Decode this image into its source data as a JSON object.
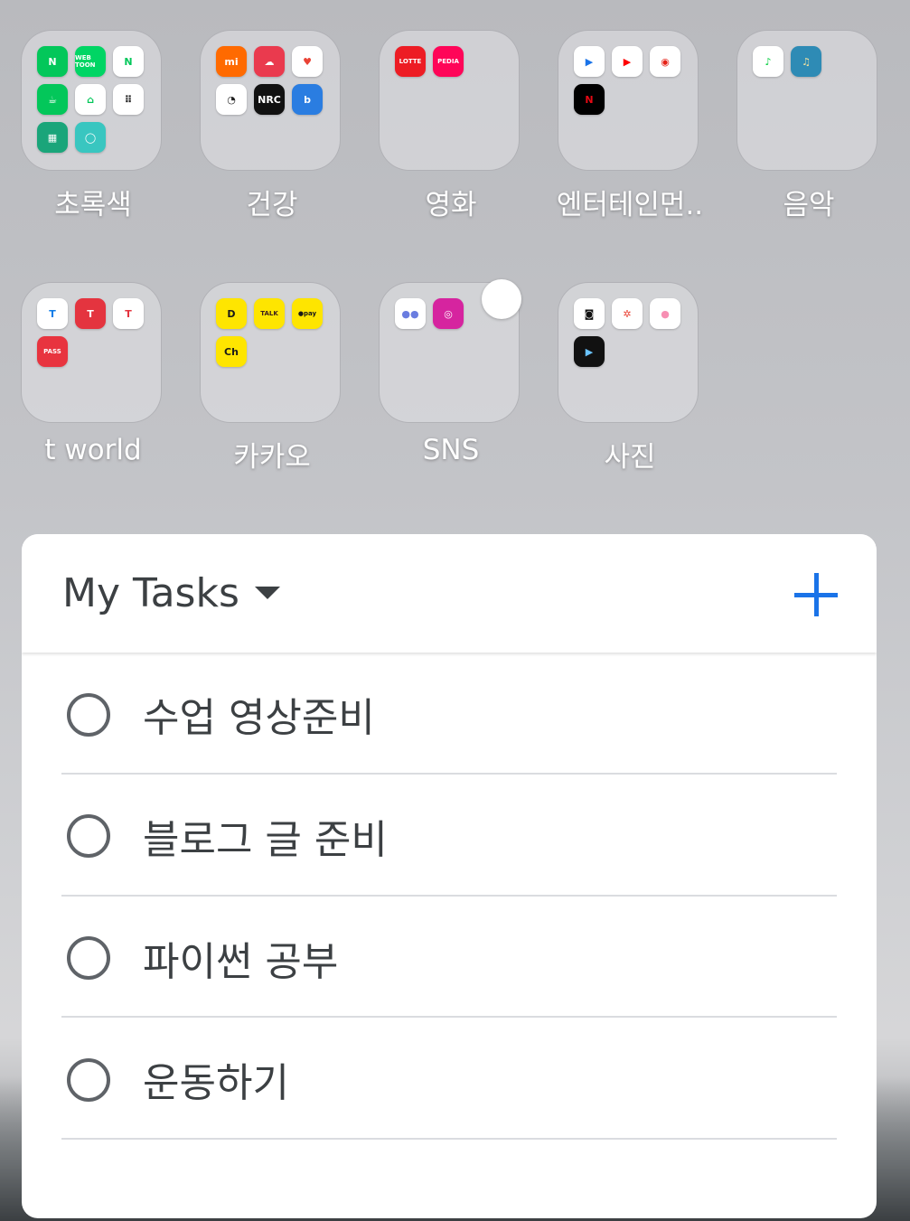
{
  "folders": [
    {
      "label": "초록색",
      "apps": [
        {
          "name": "naver-icon",
          "text": "N",
          "bg": "#03c75a",
          "fg": "#ffffff"
        },
        {
          "name": "webtoon-icon",
          "text": "WEB TOON",
          "bg": "#00d564",
          "fg": "#ffffff"
        },
        {
          "name": "naver-map-icon",
          "text": "N",
          "bg": "#ffffff",
          "fg": "#03c75a"
        },
        {
          "name": "cafe-icon",
          "text": "☕",
          "bg": "#03c75a",
          "fg": "#ffffff"
        },
        {
          "name": "real-estate-icon",
          "text": "⌂",
          "bg": "#ffffff",
          "fg": "#03c75a"
        },
        {
          "name": "dots-app-icon",
          "text": "⠿",
          "bg": "#ffffff",
          "fg": "#222222"
        },
        {
          "name": "building-icon",
          "text": "▦",
          "bg": "#1aa57a",
          "fg": "#ffffff"
        },
        {
          "name": "circle-app-icon",
          "text": "◯",
          "bg": "#39c6c0",
          "fg": "#ffffff"
        }
      ]
    },
    {
      "label": "건강",
      "apps": [
        {
          "name": "mi-fit-icon",
          "text": "mi",
          "bg": "#ff6a00",
          "fg": "#ffffff"
        },
        {
          "name": "health-cloud-icon",
          "text": "☁",
          "bg": "#ea3a4e",
          "fg": "#ffffff"
        },
        {
          "name": "google-fit-icon",
          "text": "♥",
          "bg": "#ffffff",
          "fg": "#e94235"
        },
        {
          "name": "timer-icon",
          "text": "◔",
          "bg": "#ffffff",
          "fg": "#222222"
        },
        {
          "name": "nike-run-club-icon",
          "text": "NRC",
          "bg": "#111111",
          "fg": "#ffffff"
        },
        {
          "name": "blue-fit-icon",
          "text": "b",
          "bg": "#2a7de1",
          "fg": "#ffffff"
        }
      ]
    },
    {
      "label": "영화",
      "apps": [
        {
          "name": "lotte-cinema-icon",
          "text": "LOTTE",
          "bg": "#ed1c24",
          "fg": "#ffffff"
        },
        {
          "name": "watcha-pedia-icon",
          "text": "PEDIA",
          "bg": "#ff0558",
          "fg": "#ffffff"
        }
      ]
    },
    {
      "label": "엔터테인먼..",
      "apps": [
        {
          "name": "play-store-icon",
          "text": "▶",
          "bg": "#ffffff",
          "fg": "#1a73e8"
        },
        {
          "name": "youtube-icon",
          "text": "▶",
          "bg": "#ffffff",
          "fg": "#ff0000"
        },
        {
          "name": "youtube-music-icon",
          "text": "◉",
          "bg": "#ffffff",
          "fg": "#e62117"
        },
        {
          "name": "netflix-icon",
          "text": "N",
          "bg": "#000000",
          "fg": "#e50914"
        }
      ]
    },
    {
      "label": "음악",
      "apps": [
        {
          "name": "melon-icon",
          "text": "♪",
          "bg": "#ffffff",
          "fg": "#00cd3c"
        },
        {
          "name": "tuner-icon",
          "text": "♫",
          "bg": "#2e8bb5",
          "fg": "#f4e2a0"
        }
      ]
    },
    {
      "label": "t world",
      "apps": [
        {
          "name": "tmap-icon",
          "text": "T",
          "bg": "#ffffff",
          "fg": "#0d7ce8"
        },
        {
          "name": "t-world-icon",
          "text": "T",
          "bg": "#e4343f",
          "fg": "#ffffff"
        },
        {
          "name": "t-membership-icon",
          "text": "T",
          "bg": "#ffffff",
          "fg": "#e4343f"
        },
        {
          "name": "pass-icon",
          "text": "PASS",
          "bg": "#e8343f",
          "fg": "#ffffff"
        }
      ]
    },
    {
      "label": "카카오",
      "apps": [
        {
          "name": "kakao-d-icon",
          "text": "D",
          "bg": "#fee500",
          "fg": "#191919"
        },
        {
          "name": "kakaotalk-icon",
          "text": "TALK",
          "bg": "#fee500",
          "fg": "#3c1e1e"
        },
        {
          "name": "kakaopay-icon",
          "text": "●pay",
          "bg": "#fee500",
          "fg": "#191919"
        },
        {
          "name": "kakao-channel-icon",
          "text": "Ch",
          "bg": "#fee500",
          "fg": "#191919"
        }
      ]
    },
    {
      "label": "SNS",
      "apps": [
        {
          "name": "sns-circles-icon",
          "text": "●●",
          "bg": "#ffffff",
          "fg": "#6a7de0"
        },
        {
          "name": "instagram-icon",
          "text": "◎",
          "bg": "#d6249f",
          "fg": "#ffffff"
        }
      ]
    },
    {
      "label": "사진",
      "apps": [
        {
          "name": "canon-camera-icon",
          "text": "◙",
          "bg": "#ffffff",
          "fg": "#111111"
        },
        {
          "name": "google-photos-icon",
          "text": "✲",
          "bg": "#ffffff",
          "fg": "#ea4335"
        },
        {
          "name": "gradient-circle-icon",
          "text": "●",
          "bg": "#ffffff",
          "fg": "#f78fb3"
        },
        {
          "name": "video-player-icon",
          "text": "▶",
          "bg": "#111111",
          "fg": "#6ac3ff"
        }
      ]
    }
  ],
  "widget": {
    "title": "My Tasks",
    "tasks": [
      "수업 영상준비",
      "블로그 글 준비",
      "파이썬 공부",
      "운동하기"
    ]
  }
}
